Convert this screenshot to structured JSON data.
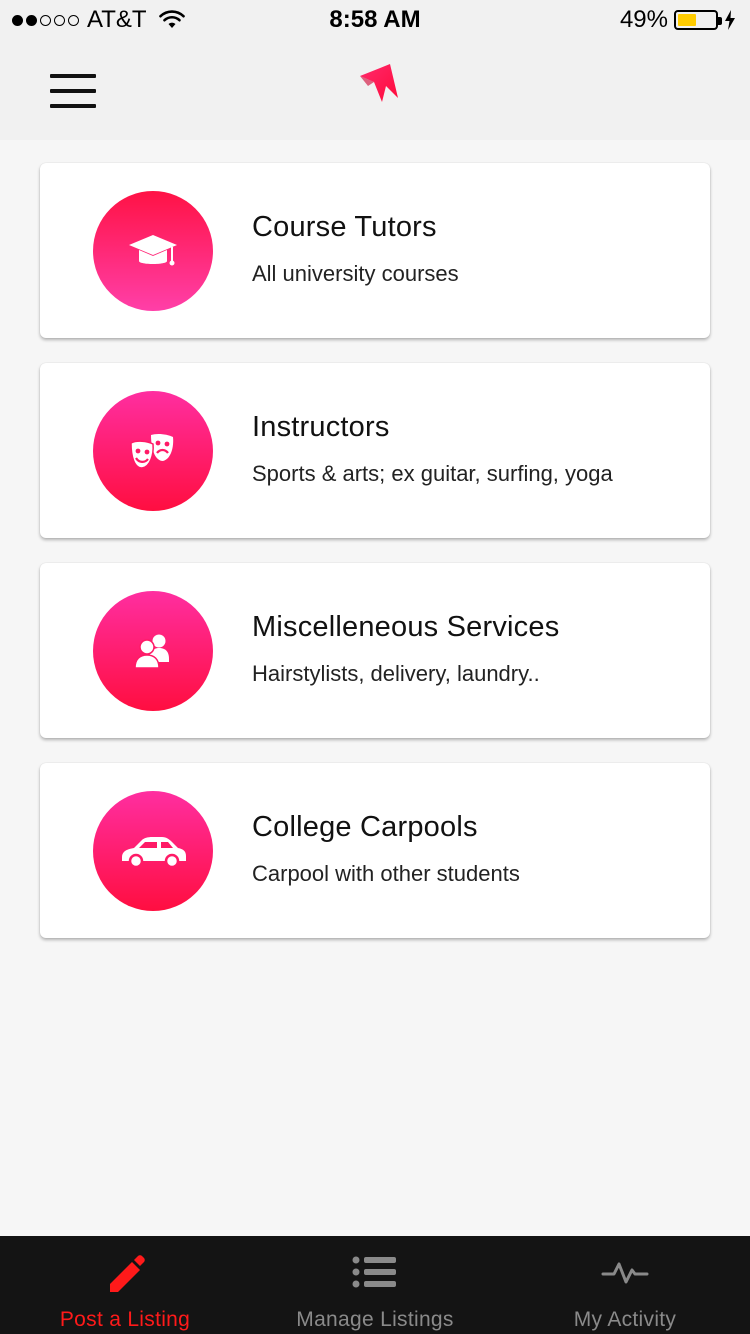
{
  "status_bar": {
    "carrier": "AT&T",
    "time": "8:58 AM",
    "battery_percent": "49%",
    "battery_level": 0.49,
    "signal_bars_filled": 2,
    "signal_bars_total": 5
  },
  "nav": {
    "menu_icon": "hamburger-menu-icon",
    "logo_icon": "arrow-logo-icon"
  },
  "categories": [
    {
      "title": "Course Tutors",
      "subtitle": "All university courses",
      "icon": "graduation-cap-icon"
    },
    {
      "title": "Instructors",
      "subtitle": "Sports & arts; ex guitar, surfing, yoga",
      "icon": "theater-masks-icon"
    },
    {
      "title": "Miscelleneous Services",
      "subtitle": "Hairstylists, delivery, laundry..",
      "icon": "users-icon"
    },
    {
      "title": "College Carpools",
      "subtitle": "Carpool with other students",
      "icon": "car-icon"
    }
  ],
  "tabs": [
    {
      "label": "Post a Listing",
      "icon": "pencil-icon",
      "active": true
    },
    {
      "label": "Manage Listings",
      "icon": "list-icon",
      "active": false
    },
    {
      "label": "My Activity",
      "icon": "pulse-icon",
      "active": false
    }
  ],
  "colors": {
    "accent_red": "#ff1a1a",
    "gradient_pink": "#ff3fa8",
    "gradient_red": "#ff1245",
    "battery_yellow": "#ffcc00",
    "tab_bar_bg": "#141414"
  }
}
